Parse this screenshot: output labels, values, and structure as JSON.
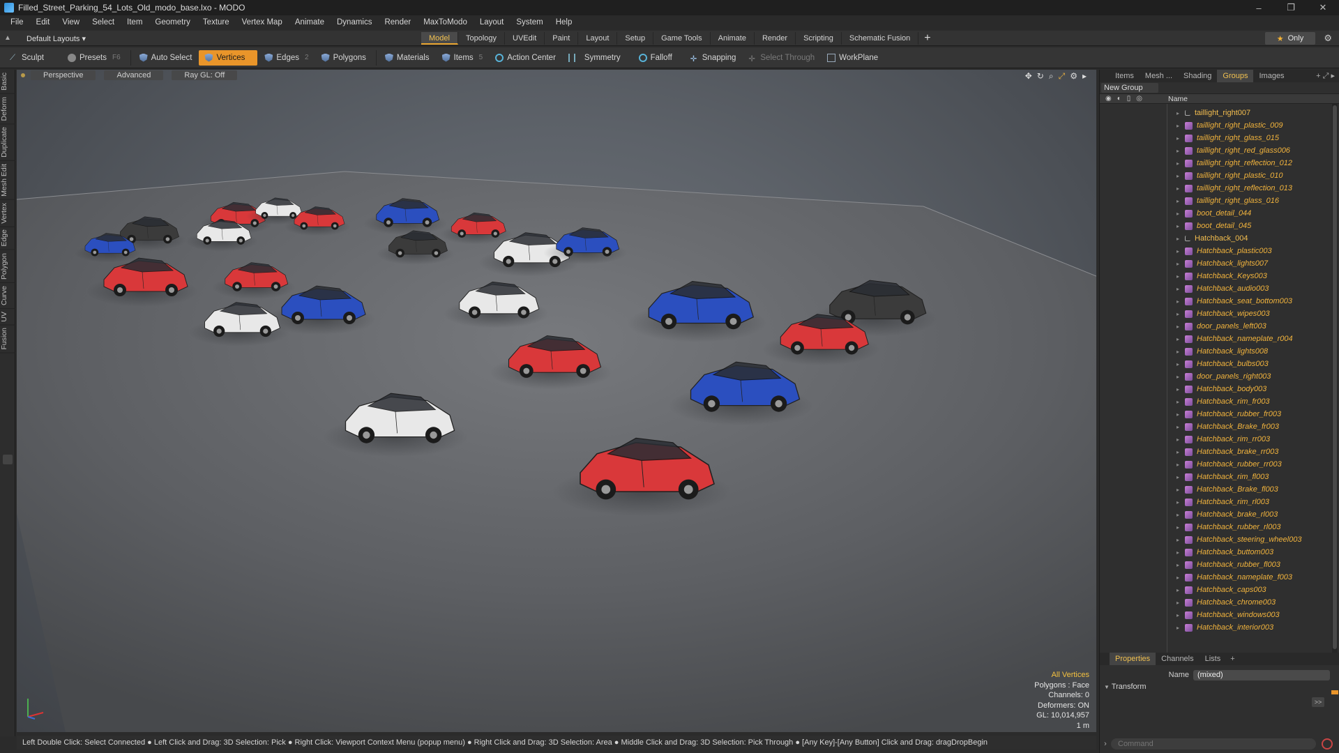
{
  "window": {
    "title": "Filled_Street_Parking_54_Lots_Old_modo_base.lxo - MODO",
    "controls": [
      "–",
      "❐",
      "✕"
    ]
  },
  "menu": [
    "File",
    "Edit",
    "View",
    "Select",
    "Item",
    "Geometry",
    "Texture",
    "Vertex Map",
    "Animate",
    "Dynamics",
    "Render",
    "MaxToModo",
    "Layout",
    "System",
    "Help"
  ],
  "layoutbar": {
    "layout_select": "Default Layouts ▾",
    "tabs": [
      "Model",
      "Topology",
      "UVEdit",
      "Paint",
      "Layout",
      "Setup",
      "Game Tools",
      "Animate",
      "Render",
      "Scripting",
      "Schematic Fusion"
    ],
    "active_tab": "Model",
    "add_tab": "+",
    "only_label": "Only"
  },
  "toolbar": {
    "sculpt": "Sculpt",
    "presets": "Presets",
    "presets_key": "F6",
    "auto_select": "Auto Select",
    "vertices": "Vertices",
    "edges": "Edges",
    "edges_count": "2",
    "polygons": "Polygons",
    "materials": "Materials",
    "items": "Items",
    "items_count": "5",
    "action_center": "Action Center",
    "symmetry": "Symmetry",
    "falloff": "Falloff",
    "snapping": "Snapping",
    "select_through": "Select Through",
    "workplane": "WorkPlane"
  },
  "left_tabs": [
    "Basic",
    "Deform",
    "Duplicate",
    "Mesh Edit",
    "Vertex",
    "Edge",
    "Polygon",
    "Curve",
    "UV",
    "Fusion"
  ],
  "viewport": {
    "view_mode": "Perspective",
    "shading": "Advanced",
    "raygl": "Ray GL: Off",
    "info": {
      "selection": "All Vertices",
      "polygons": "Polygons : Face",
      "channels": "Channels: 0",
      "deformers": "Deformers: ON",
      "gl": "GL: 10,014,957",
      "scale": "1 m"
    }
  },
  "statusbar": "Left Double Click: Select Connected ● Left Click and Drag: 3D Selection: Pick ● Right Click: Viewport Context Menu (popup menu) ● Right Click and Drag: 3D Selection: Area ● Middle Click and Drag: 3D Selection: Pick Through ● [Any Key]-[Any Button] Click and Drag: dragDropBegin",
  "right_panel": {
    "tabs": [
      "Items",
      "Mesh ...",
      "Shading",
      "Groups",
      "Images"
    ],
    "active_tab": "Groups",
    "new_group": "New Group",
    "column_name": "Name",
    "tree": [
      {
        "label": "taillight_right007",
        "kind": "locator"
      },
      {
        "label": "taillight_right_plastic_009",
        "kind": "mesh"
      },
      {
        "label": "taillight_right_glass_015",
        "kind": "mesh"
      },
      {
        "label": "taillight_right_red_glass006",
        "kind": "mesh"
      },
      {
        "label": "taillight_right_reflection_012",
        "kind": "mesh"
      },
      {
        "label": "taillight_right_plastic_010",
        "kind": "mesh"
      },
      {
        "label": "taillight_right_reflection_013",
        "kind": "mesh"
      },
      {
        "label": "taillight_right_glass_016",
        "kind": "mesh"
      },
      {
        "label": "boot_detail_044",
        "kind": "mesh"
      },
      {
        "label": "boot_detail_045",
        "kind": "mesh"
      },
      {
        "label": "Hatchback_004",
        "kind": "locator"
      },
      {
        "label": "Hatchback_plastic003",
        "kind": "mesh"
      },
      {
        "label": "Hatchback_lights007",
        "kind": "mesh"
      },
      {
        "label": "Hatchback_Keys003",
        "kind": "mesh"
      },
      {
        "label": "Hatchback_audio003",
        "kind": "mesh"
      },
      {
        "label": "Hatchback_seat_bottom003",
        "kind": "mesh"
      },
      {
        "label": "Hatchback_wipes003",
        "kind": "mesh"
      },
      {
        "label": "door_panels_left003",
        "kind": "mesh"
      },
      {
        "label": "Hatchback_nameplate_r004",
        "kind": "mesh"
      },
      {
        "label": "Hatchback_lights008",
        "kind": "mesh"
      },
      {
        "label": "Hatchback_bulbs003",
        "kind": "mesh"
      },
      {
        "label": "door_panels_right003",
        "kind": "mesh"
      },
      {
        "label": "Hatchback_body003",
        "kind": "mesh"
      },
      {
        "label": "Hatchback_rim_fr003",
        "kind": "mesh"
      },
      {
        "label": "Hatchback_rubber_fr003",
        "kind": "mesh"
      },
      {
        "label": "Hatchback_Brake_fr003",
        "kind": "mesh"
      },
      {
        "label": "Hatchback_rim_rr003",
        "kind": "mesh"
      },
      {
        "label": "Hatchback_brake_rr003",
        "kind": "mesh"
      },
      {
        "label": "Hatchback_rubber_rr003",
        "kind": "mesh"
      },
      {
        "label": "Hatchback_rim_fl003",
        "kind": "mesh"
      },
      {
        "label": "Hatchback_Brake_fl003",
        "kind": "mesh"
      },
      {
        "label": "Hatchback_rim_rl003",
        "kind": "mesh"
      },
      {
        "label": "Hatchback_brake_rl003",
        "kind": "mesh"
      },
      {
        "label": "Hatchback_rubber_rl003",
        "kind": "mesh"
      },
      {
        "label": "Hatchback_steering_wheel003",
        "kind": "mesh"
      },
      {
        "label": "Hatchback_buttom003",
        "kind": "mesh"
      },
      {
        "label": "Hatchback_rubber_fl003",
        "kind": "mesh"
      },
      {
        "label": "Hatchback_nameplate_f003",
        "kind": "mesh"
      },
      {
        "label": "Hatchback_caps003",
        "kind": "mesh"
      },
      {
        "label": "Hatchback_chrome003",
        "kind": "mesh"
      },
      {
        "label": "Hatchback_windows003",
        "kind": "mesh"
      },
      {
        "label": "Hatchback_interior003",
        "kind": "mesh"
      }
    ]
  },
  "properties": {
    "tabs": [
      "Properties",
      "Channels",
      "Lists"
    ],
    "active_tab": "Properties",
    "add": "+",
    "name_label": "Name",
    "name_value": "(mixed)",
    "section": "Transform",
    "expand": ">>",
    "command_placeholder": "Command"
  },
  "colors": {
    "accent": "#e9952a",
    "tree_text": "#f1b33d",
    "red_car": "#d9383a",
    "blue_car": "#2b4fbf",
    "white_car": "#e8e8e8",
    "dark_car": "#3b3b3b"
  }
}
